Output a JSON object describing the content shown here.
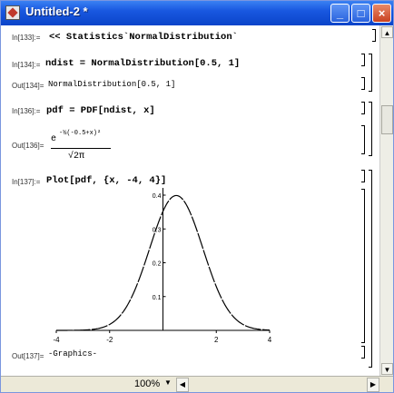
{
  "window": {
    "title": "Untitled-2 *"
  },
  "cells": [
    {
      "label": "In[133]:=",
      "input": "<< Statistics`NormalDistribution`"
    },
    {
      "label": "In[134]:=",
      "input": "ndist = NormalDistribution[0.5, 1]"
    },
    {
      "label": "Out[134]=",
      "output": "NormalDistribution[0.5, 1]"
    },
    {
      "label": "In[136]:=",
      "input": "pdf = PDF[ndist, x]"
    },
    {
      "label": "Out[136]=",
      "output_exponent": "-½(-0.5+x)²",
      "output_base": "e",
      "output_denominator": "√2π"
    },
    {
      "label": "In[137]:=",
      "input": "Plot[pdf, {x, -4, 4}]"
    },
    {
      "label": "Out[137]=",
      "output": "-Graphics-"
    }
  ],
  "chart_data": {
    "type": "line",
    "function": "PDF[NormalDistribution[0.5, 1], x]",
    "mean": 0.5,
    "sd": 1,
    "xlim": [
      -4,
      4
    ],
    "ylim": [
      0,
      0.4
    ],
    "x_ticks": [
      "-4",
      "-2",
      "2",
      "4"
    ],
    "y_ticks": [
      "0.1",
      "0.2",
      "0.3",
      "0.4"
    ],
    "grid": false
  },
  "statusbar": {
    "zoom": "100%"
  },
  "colors": {
    "titlebar": "#1958e0",
    "curve": "#000000"
  }
}
